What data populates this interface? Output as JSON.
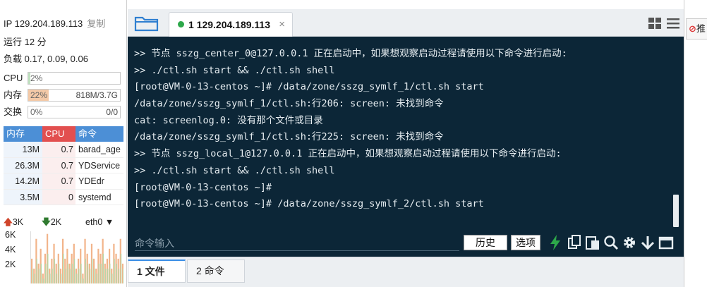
{
  "sysinfo": {
    "ip_label": "IP 129.204.189.113",
    "copy_label": "复制",
    "uptime": "运行 12 分",
    "load": "负载 0.17, 0.09, 0.06"
  },
  "meters": {
    "cpu": {
      "label": "CPU",
      "pct_text": "2%",
      "fill": 0.02,
      "extra": ""
    },
    "mem": {
      "label": "内存",
      "pct_text": "22%",
      "fill": 0.22,
      "extra": "818M/3.7G"
    },
    "swap": {
      "label": "交换",
      "pct_text": "0%",
      "fill": 0.0,
      "extra": "0/0"
    }
  },
  "proc_table": {
    "headers": [
      "内存",
      "CPU",
      "命令"
    ],
    "rows": [
      {
        "mem": "13M",
        "cpu": "0.7",
        "cmd": "barad_age"
      },
      {
        "mem": "26.3M",
        "cpu": "0.7",
        "cmd": "YDService"
      },
      {
        "mem": "14.2M",
        "cpu": "0.7",
        "cmd": "YDEdr"
      },
      {
        "mem": "3.5M",
        "cpu": "0",
        "cmd": "systemd"
      }
    ]
  },
  "network": {
    "up_rate": "3K",
    "down_rate": "2K",
    "interface": "eth0",
    "y_ticks": [
      "6K",
      "4K",
      "2K"
    ],
    "up_series": [
      0.5,
      0.3,
      0.9,
      0.4,
      0.7,
      0.2,
      0.6,
      1.0,
      0.3,
      0.5,
      0.8,
      0.4,
      0.6,
      0.3,
      0.9,
      0.5,
      0.7,
      0.4,
      0.6,
      0.8,
      0.3,
      0.5,
      0.7,
      0.2,
      0.9,
      0.6,
      0.4,
      0.8,
      0.5,
      0.3,
      0.7,
      0.6,
      0.9,
      0.4,
      0.5,
      0.7,
      0.3,
      0.8,
      0.6,
      0.5,
      0.9,
      0.4
    ],
    "down_series": [
      0.3,
      0.2,
      0.5,
      0.3,
      0.4,
      0.1,
      0.4,
      0.6,
      0.2,
      0.3,
      0.5,
      0.2,
      0.4,
      0.2,
      0.6,
      0.3,
      0.4,
      0.3,
      0.4,
      0.5,
      0.2,
      0.3,
      0.4,
      0.1,
      0.5,
      0.4,
      0.3,
      0.5,
      0.3,
      0.2,
      0.4,
      0.4,
      0.6,
      0.3,
      0.3,
      0.4,
      0.2,
      0.5,
      0.4,
      0.3,
      0.6,
      0.3
    ]
  },
  "tabs": {
    "session": {
      "label": "1 129.204.189.113",
      "close": "×"
    }
  },
  "terminal": {
    "lines": [
      ">> 节点 sszg_center_0@127.0.0.1 正在启动中，如果想观察启动过程请使用以下命令进行启动:",
      ">> ./ctl.sh start && ./ctl.sh shell",
      "[root@VM-0-13-centos ~]# /data/zone/sszg_symlf_1/ctl.sh start",
      "/data/zone/sszg_symlf_1/ctl.sh:行206: screen: 未找到命令",
      "cat: screenlog.0: 没有那个文件或目录",
      "/data/zone/sszg_symlf_1/ctl.sh:行225: screen: 未找到命令",
      ">> 节点 sszg_local_1@127.0.0.1 正在启动中，如果想观察启动过程请使用以下命令进行启动:",
      ">> ./ctl.sh start && ./ctl.sh shell",
      "[root@VM-0-13-centos ~]#",
      "[root@VM-0-13-centos ~]# /data/zone/sszg_symlf_2/ctl.sh start"
    ],
    "input_placeholder": "命令输入",
    "history_label": "历史",
    "options_label": "选项"
  },
  "bottom_tabs": {
    "files": "1 文件",
    "commands": "2 命令"
  },
  "side": {
    "label": "推"
  },
  "colors": {
    "terminal_bg": "#0c2637",
    "mem_fill": "#f3c9a7",
    "cpu_fill": "#bfe0bf",
    "accent_blue": "#3a8ee6",
    "lightning": "#2da84a"
  }
}
